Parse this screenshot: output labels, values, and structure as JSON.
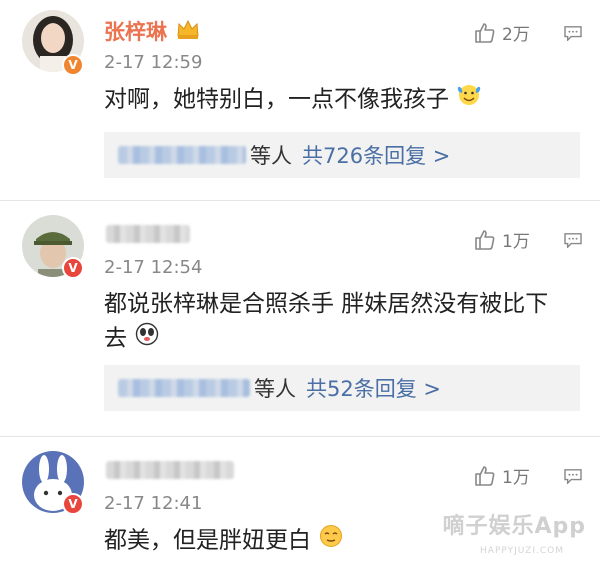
{
  "comments": [
    {
      "author": "张梓琳",
      "author_blurred": false,
      "time": "2-17 12:59",
      "text": "对啊，她特别白，一点不像我孩子",
      "likes": "2万",
      "reply_suffix": "等人",
      "reply_count": "共726条回复 >",
      "badge": "orange"
    },
    {
      "author": "",
      "author_blurred": true,
      "time": "2-17 12:54",
      "text_line1": "都说张梓琳是合照杀手 胖妹居然没有被比下",
      "text_line2": "去",
      "likes": "1万",
      "reply_suffix": "等人",
      "reply_count": "共52条回复 >",
      "badge": "red"
    },
    {
      "author": "",
      "author_blurred": true,
      "time": "2-17 12:41",
      "text": "都美，但是胖妞更白",
      "likes": "1万",
      "badge": "red"
    }
  ],
  "watermark": "嘀子娱乐App",
  "watermark_sub": "HAPPYJUZI.COM",
  "colors": {
    "name": "#eb7350",
    "link": "#4a6fa5",
    "badge_red": "#e8453c",
    "badge_orange": "#f0852d"
  }
}
